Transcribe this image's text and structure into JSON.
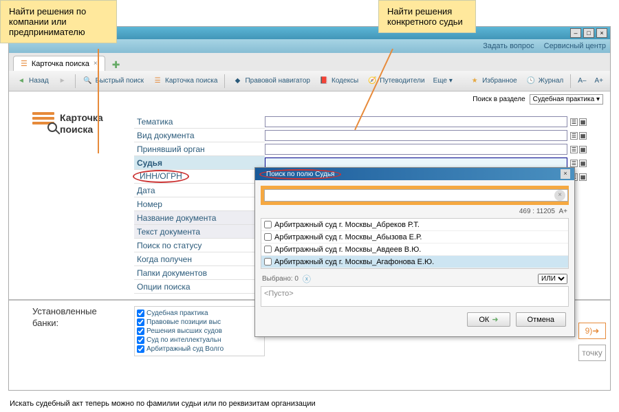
{
  "callouts": {
    "company": "Найти решения по компании или предпринимателю",
    "judge": "Найти решения конкретного судьи"
  },
  "window": {
    "menu": {
      "ask": "Задать вопрос",
      "service": "Сервисный центр"
    },
    "tab": {
      "title": "Карточка поиска"
    },
    "toolbar": {
      "back": "Назад",
      "quick_search": "Быстрый поиск",
      "search_card": "Карточка поиска",
      "legal_nav": "Правовой навигатор",
      "codes": "Кодексы",
      "guides": "Путеводители",
      "more": "Еще",
      "favorites": "Избранное",
      "journal": "Журнал"
    },
    "subbar": {
      "search_section": "Поиск в разделе",
      "section_value": "Судебная практика"
    }
  },
  "card": {
    "title_line1": "Карточка",
    "title_line2": "поиска",
    "fields": {
      "theme": "Тематика",
      "doc_type": "Вид документа",
      "authority": "Принявший орган",
      "judge": "Судья",
      "inn": "ИНН/ОГРН",
      "date": "Дата",
      "number": "Номер",
      "doc_name": "Название документа",
      "doc_text": "Текст документа",
      "status": "Поиск по статусу",
      "received": "Когда получен",
      "folders": "Папки документов",
      "options": "Опции поиска"
    }
  },
  "banks": {
    "label_line1": "Установленные",
    "label_line2": "банки:",
    "items": [
      "Судебная практика",
      "Правовые позиции выс",
      "Решения высших судов",
      "Суд по интеллектуальн",
      "Арбитражный суд Волго"
    ]
  },
  "popup": {
    "title": "Поиск по полю Судья",
    "count": "469 : 11205",
    "font_plus": "A+",
    "items": [
      "Арбитражный суд г. Москвы_Абреков Р.Т.",
      "Арбитражный суд г. Москвы_Абызова Е.Р.",
      "Арбитражный суд г. Москвы_Авдеев В.Ю.",
      "Арбитражный суд г. Москвы_Агафонова Е.Ю."
    ],
    "selected_label": "Выбрано: 0",
    "logic": "ИЛИ",
    "empty": "<Пусто>",
    "ok": "ОК",
    "cancel": "Отмена"
  },
  "results_hint": "9)",
  "search_card_hint": "точку",
  "caption": "Искать судебный акт теперь можно по фамилии судьи или по реквизитам организации"
}
